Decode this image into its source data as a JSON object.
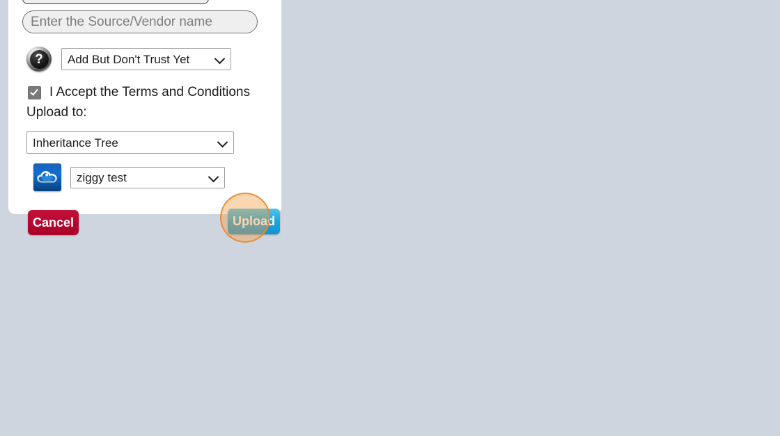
{
  "page": {
    "background_color": "#ced5de"
  },
  "dialog": {
    "panel_background": "#ffffff",
    "title_input": {
      "value": "",
      "placeholder": ""
    },
    "vendor_input": {
      "value": "",
      "placeholder": "Enter the Source/Vendor name"
    },
    "help_icon": {
      "name": "help-question-icon",
      "glyph": "?"
    },
    "trust_select": {
      "selected": "Add But Don't Trust Yet",
      "options": [
        "Add But Don't Trust Yet"
      ]
    },
    "terms": {
      "checked": true,
      "label": "I Accept the Terms and Conditions"
    },
    "upload_to_label": "Upload to:",
    "tree_select": {
      "selected": "Inheritance Tree",
      "options": [
        "Inheritance Tree"
      ]
    },
    "account": {
      "icon_name": "cloud-tree-icon",
      "select": {
        "selected": "ziggy test",
        "options": [
          "ziggy test"
        ]
      }
    },
    "buttons": {
      "cancel_label": "Cancel",
      "cancel_color": "#b5062f",
      "upload_label": "Upload",
      "upload_color": "#1fa5e0"
    }
  },
  "cursor_highlight": {
    "fill_color": "#f5a046",
    "ring_color": "#e98830"
  }
}
